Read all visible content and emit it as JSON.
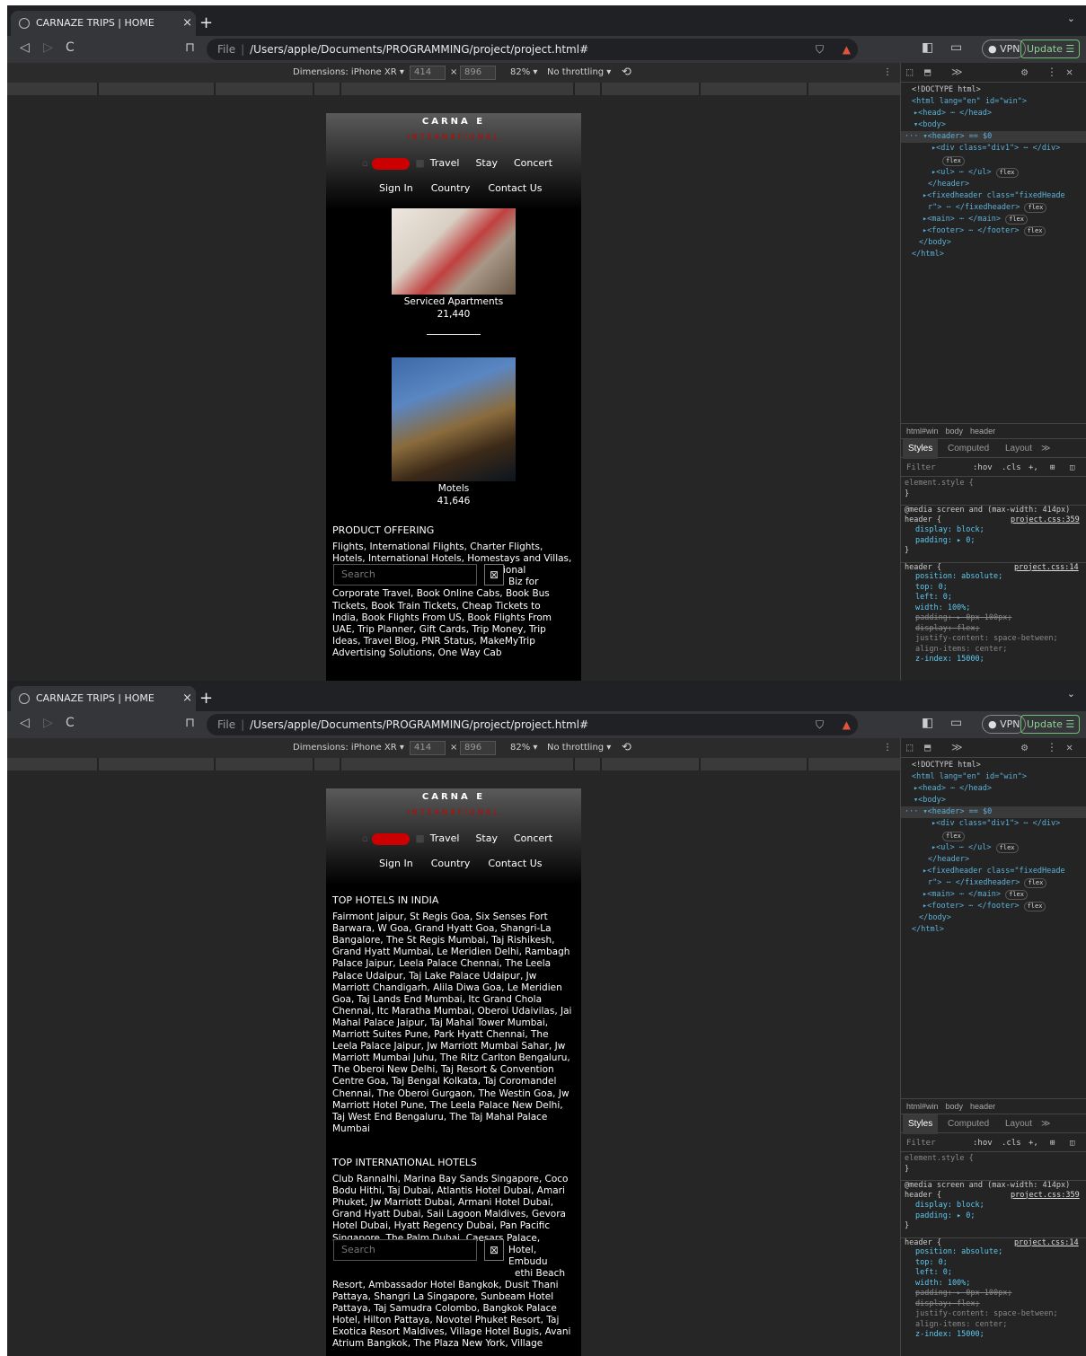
{
  "browser": {
    "tab_title": "CARNAZE TRIPS | HOME",
    "close_tab": "×",
    "new_tab": "+",
    "tab_menu": "⌄",
    "back": "◁",
    "forward": "▷",
    "reload": "C",
    "bookmark": "⊓",
    "url_label": "File",
    "url": "/Users/apple/Documents/PROGRAMMING/project/project.html#",
    "vpn": "● VPN",
    "update": "Update ☰"
  },
  "device_toolbar": {
    "dimensions": "Dimensions: iPhone XR ▾",
    "width": "414",
    "times": "×",
    "height": "896",
    "zoom": "82% ▾",
    "throttle": "No throttling ▾",
    "rotate": "⟲",
    "kebab": "⋮"
  },
  "site": {
    "logo_top": "CARNA E",
    "logo_bottom": "INTERNATIONAL",
    "nav_home": "HOME",
    "nav_travel": "Travel",
    "nav_stay": "Stay",
    "nav_concert": "Concert",
    "nav_signin": "Sign In",
    "nav_country": "Country",
    "nav_contact": "Contact Us",
    "search_placeholder": "Search",
    "search_button": "⊠"
  },
  "view1": {
    "card1_title": "Serviced Apartments",
    "card1_count": "21,440",
    "card2_title": "Motels",
    "card2_count": "41,646",
    "section_title": "PRODUCT OFFERING",
    "lines": [
      "Flights, International Flights, Charter Flights,",
      "Hotels, International Hotels, Homestays and Villas,",
      "ional",
      "Biz for",
      "Corporate Travel, Book Online Cabs, Book Bus",
      "Tickets, Book Train Tickets, Cheap Tickets to",
      "India, Book Flights From US, Book Flights From",
      "UAE, Trip Planner, Gift Cards, Trip Money, Trip",
      "Ideas, Travel Blog, PNR Status, MakeMyTrip",
      "Advertising Solutions, One Way Cab"
    ]
  },
  "view2": {
    "section1_title": "TOP HOTELS IN INDIA",
    "section1_lines": [
      "Fairmont Jaipur, St Regis Goa, Six Senses Fort",
      "Barwara, W Goa, Grand Hyatt Goa, Shangri-La",
      "Bangalore, The St Regis Mumbai, Taj Rishikesh,",
      "Grand Hyatt Mumbai, Le Meridien Delhi, Rambagh",
      "Palace Jaipur, Leela Palace Chennai, The Leela",
      "Palace Udaipur, Taj Lake Palace Udaipur, Jw",
      "Marriott Chandigarh, Alila Diwa Goa, Le Meridien",
      "Goa, Taj Lands End Mumbai, Itc Grand Chola",
      "Chennai, Itc Maratha Mumbai, Oberoi Udaivilas, Jai",
      "Mahal Palace Jaipur, Taj Mahal Tower Mumbai,",
      "Marriott Suites Pune, Park Hyatt Chennai, The",
      "Leela Palace Jaipur, Jw Marriott Mumbai Sahar, Jw",
      "Marriott Mumbai Juhu, The Ritz Carlton Bengaluru,",
      "The Oberoi New Delhi, Taj Resort & Convention",
      "Centre Goa, Taj Bengal Kolkata, Taj Coromandel",
      "Chennai, The Oberoi Gurgaon, The Westin Goa, Jw",
      "Marriott Hotel Pune, The Leela Palace New Delhi,",
      "Taj West End Bengaluru, The Taj Mahal Palace",
      "Mumbai"
    ],
    "section2_title": "TOP INTERNATIONAL HOTELS",
    "section2_lines": [
      "Club Rannalhi, Marina Bay Sands Singapore, Coco",
      "Bodu Hithi, Taj Dubai, Atlantis Hotel Dubai, Amari",
      "Phuket, Jw Marriott Dubai, Armani Hotel Dubai,",
      "Grand Hyatt Dubai, Saii Lagoon Maldives, Gevora",
      "Hotel Dubai, Hyatt Regency Dubai, Pan Pacific",
      "Singapore, The Palm Dubai, Caesars Palace,",
      "Hotel, Embudu",
      "ethi Beach",
      "Resort, Ambassador Hotel Bangkok, Dusit Thani",
      "Pattaya, Shangri La Singapore, Sunbeam Hotel",
      "Pattaya, Taj Samudra Colombo, Bangkok Palace",
      "Hotel, Hilton Pattaya, Novotel Phuket Resort, Taj",
      "Exotica Resort Maldives, Village Hotel Bugis, Avani",
      "Atrium Bangkok, The Plaza New York, Village"
    ]
  },
  "devtools": {
    "top_icons": [
      "⬚",
      "⬒",
      "≫",
      "⚙",
      "⋮",
      "✕"
    ],
    "dom": [
      "<!DOCTYPE html>",
      "<html lang=\"en\" id=\"win\">",
      "▸<head> ⋯ </head>",
      "▾<body>",
      "··· ▾<header> == $0",
      "▸<div class=\"div1\"> ⋯ </div>",
      "flex",
      "▸<ul> ⋯ </ul>",
      "flex",
      "</header>",
      "▸<fixedheader class=\"fixedHeade",
      "r\"> ⋯ </fixedheader>",
      "flex",
      "▸<main> ⋯ </main>",
      "flex",
      "▸<footer> ⋯ </footer>",
      "flex",
      "</body>",
      "</html>"
    ],
    "crumbs": [
      "html#win",
      "body",
      "header"
    ],
    "tabs": [
      "Styles",
      "Computed",
      "Layout",
      "≫"
    ],
    "filter": "Filter",
    "hov": ":hov",
    "cls": ".cls",
    "plus": "+,",
    "css_lines": [
      "element.style {",
      "}",
      "@media screen and (max-width: 414px)",
      "header {",
      "project.css:359",
      "display: block;",
      "padding: ▸ 0;",
      "}",
      "header {",
      "project.css:14",
      "position: absolute;",
      "top: 0;",
      "left: 0;",
      "width: 100%;",
      "padding: ▸ 0px 100px;",
      "display: flex;",
      "justify-content: space-between;",
      "align-items: center;",
      "z-index: 15000;"
    ]
  }
}
